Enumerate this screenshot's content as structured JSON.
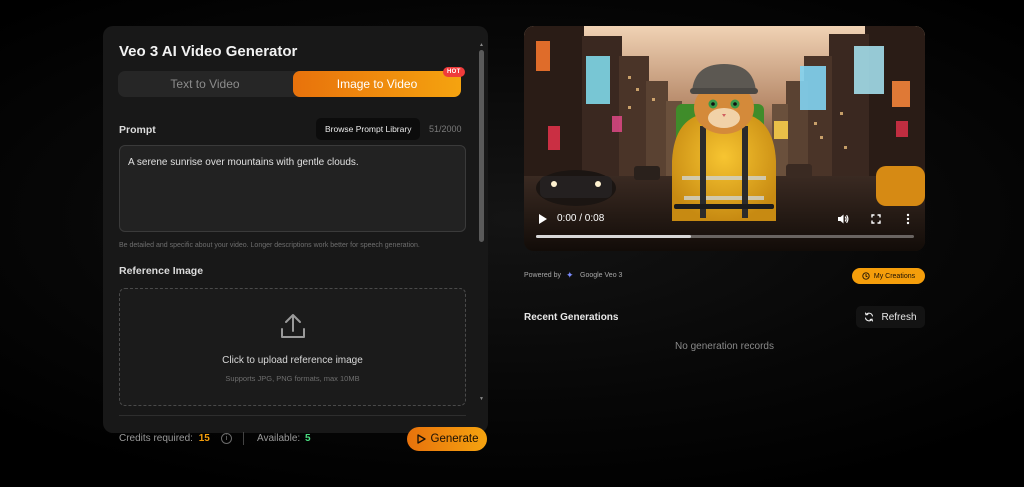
{
  "generator": {
    "title": "Veo 3 AI Video Generator",
    "tabs": [
      {
        "label": "Text to Video",
        "active": false
      },
      {
        "label": "Image to Video",
        "active": true
      }
    ],
    "hot_badge": "HOT",
    "prompt": {
      "label": "Prompt",
      "browse_label": "Browse Prompt Library",
      "char_count": "51/2000",
      "value": "A serene sunrise over mountains with gentle clouds.",
      "helper": "Be detailed and specific about your video. Longer descriptions work better for speech generation."
    },
    "reference": {
      "label": "Reference Image",
      "upload_title": "Click to upload reference image",
      "upload_sub": "Supports JPG, PNG formats, max 10MB",
      "icon": "upload-icon"
    }
  },
  "footer": {
    "credits_label": "Credits required:",
    "credits_value": "15",
    "available_label": "Available:",
    "available_value": "5",
    "generate_label": "Generate"
  },
  "video": {
    "time": "0:00 / 0:08",
    "progress_fraction": 0.41,
    "icons": [
      "play-icon",
      "volume-icon",
      "fullscreen-icon",
      "more-icon"
    ]
  },
  "meta": {
    "powered_by": "Powered by",
    "model_name": "Google Veo 3",
    "my_creations": "My Creations"
  },
  "recent": {
    "title": "Recent Generations",
    "refresh_label": "Refresh",
    "empty_message": "No generation records"
  },
  "colors": {
    "accent_start": "#e8720c",
    "accent_end": "#f5a30f",
    "credits": "#f59e0b",
    "available": "#4ade80",
    "hot": "#ef3b3b"
  }
}
